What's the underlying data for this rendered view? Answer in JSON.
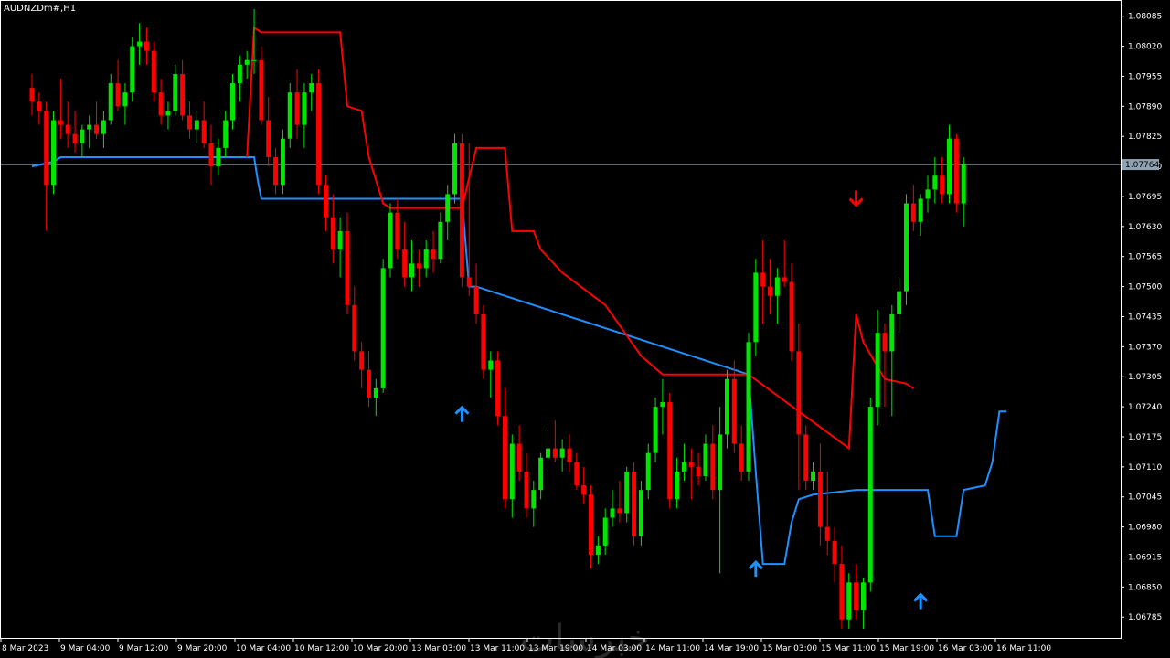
{
  "symbol_label": "AUDNZDm#,H1",
  "watermark": "خبرسات",
  "colors": {
    "background": "#000000",
    "frame": "#ffffff",
    "bull_candle": "#00e600",
    "bear_candle": "#ff0000",
    "support_line": "#1e90ff",
    "resistance_line": "#ff0000",
    "current_price_line": "#8fa3b3",
    "up_arrow": "#1e90ff",
    "down_arrow": "#ff0000"
  },
  "icons": {
    "buy_signal": "arrow-up-icon",
    "sell_signal": "arrow-down-icon"
  },
  "chart_data": {
    "type": "candlestick",
    "symbol": "AUDNZDm#",
    "timeframe": "H1",
    "ylim": [
      1.0674,
      1.0812
    ],
    "y_ticks": [
      "1.08085",
      "1.08020",
      "1.07955",
      "1.07890",
      "1.07825",
      "1.07760",
      "1.07695",
      "1.07630",
      "1.07565",
      "1.07500",
      "1.07435",
      "1.07370",
      "1.07305",
      "1.07240",
      "1.07175",
      "1.07110",
      "1.07045",
      "1.06980",
      "1.06915",
      "1.06850",
      "1.06785"
    ],
    "x_ticks": [
      "8 Mar 2023",
      "9 Mar 04:00",
      "9 Mar 12:00",
      "9 Mar 20:00",
      "10 Mar 04:00",
      "10 Mar 12:00",
      "10 Mar 20:00",
      "13 Mar 03:00",
      "13 Mar 11:00",
      "13 Mar 19:00",
      "14 Mar 03:00",
      "14 Mar 11:00",
      "14 Mar 19:00",
      "15 Mar 03:00",
      "15 Mar 11:00",
      "15 Mar 19:00",
      "16 Mar 03:00",
      "16 Mar 11:00"
    ],
    "current_price": "1.07764",
    "candles": [
      [
        1.0793,
        1.0796,
        1.0787,
        1.079
      ],
      [
        1.079,
        1.0792,
        1.0785,
        1.0788
      ],
      [
        1.0788,
        1.079,
        1.0762,
        1.0772
      ],
      [
        1.0772,
        1.0788,
        1.077,
        1.0786
      ],
      [
        1.0786,
        1.0795,
        1.0782,
        1.0785
      ],
      [
        1.0785,
        1.079,
        1.078,
        1.0783
      ],
      [
        1.0783,
        1.0788,
        1.0779,
        1.0781
      ],
      [
        1.0781,
        1.0785,
        1.0778,
        1.0784
      ],
      [
        1.0784,
        1.0787,
        1.078,
        1.0785
      ],
      [
        1.0785,
        1.079,
        1.0782,
        1.0783
      ],
      [
        1.0783,
        1.0788,
        1.078,
        1.0786
      ],
      [
        1.0786,
        1.0796,
        1.0785,
        1.0794
      ],
      [
        1.0794,
        1.0799,
        1.0788,
        1.0789
      ],
      [
        1.0789,
        1.0794,
        1.0785,
        1.0792
      ],
      [
        1.0792,
        1.0804,
        1.079,
        1.0802
      ],
      [
        1.0802,
        1.0807,
        1.0798,
        1.0803
      ],
      [
        1.0803,
        1.0806,
        1.0798,
        1.0801
      ],
      [
        1.0801,
        1.0803,
        1.079,
        1.0792
      ],
      [
        1.0792,
        1.0795,
        1.0785,
        1.0787
      ],
      [
        1.0787,
        1.079,
        1.0784,
        1.0788
      ],
      [
        1.0788,
        1.0798,
        1.0787,
        1.0796
      ],
      [
        1.0796,
        1.0799,
        1.0786,
        1.0787
      ],
      [
        1.0787,
        1.079,
        1.0782,
        1.0784
      ],
      [
        1.0784,
        1.0788,
        1.0781,
        1.0786
      ],
      [
        1.0786,
        1.079,
        1.078,
        1.0781
      ],
      [
        1.0781,
        1.0785,
        1.0772,
        1.0776
      ],
      [
        1.0776,
        1.0782,
        1.0774,
        1.078
      ],
      [
        1.078,
        1.0788,
        1.0778,
        1.0786
      ],
      [
        1.0786,
        1.0796,
        1.0784,
        1.0794
      ],
      [
        1.0794,
        1.08,
        1.079,
        1.0798
      ],
      [
        1.0798,
        1.0801,
        1.0795,
        1.0799
      ],
      [
        1.0799,
        1.081,
        1.0796,
        1.0799
      ],
      [
        1.0799,
        1.0802,
        1.0785,
        1.0786
      ],
      [
        1.0786,
        1.0791,
        1.0776,
        1.0778
      ],
      [
        1.0778,
        1.078,
        1.077,
        1.0772
      ],
      [
        1.0772,
        1.0784,
        1.077,
        1.0782
      ],
      [
        1.0782,
        1.0794,
        1.078,
        1.0792
      ],
      [
        1.0792,
        1.0797,
        1.0782,
        1.0785
      ],
      [
        1.0785,
        1.0794,
        1.078,
        1.0792
      ],
      [
        1.0792,
        1.0796,
        1.0788,
        1.0794
      ],
      [
        1.0794,
        1.0797,
        1.077,
        1.0772
      ],
      [
        1.0772,
        1.0774,
        1.0762,
        1.0765
      ],
      [
        1.0765,
        1.077,
        1.0755,
        1.0758
      ],
      [
        1.0758,
        1.0765,
        1.0752,
        1.0762
      ],
      [
        1.0762,
        1.0766,
        1.0744,
        1.0746
      ],
      [
        1.0746,
        1.075,
        1.0734,
        1.0736
      ],
      [
        1.0736,
        1.0738,
        1.0728,
        1.0732
      ],
      [
        1.0732,
        1.0736,
        1.0724,
        1.0726
      ],
      [
        1.0726,
        1.073,
        1.0722,
        1.0728
      ],
      [
        1.0728,
        1.0756,
        1.0727,
        1.0754
      ],
      [
        1.0754,
        1.0768,
        1.0752,
        1.0766
      ],
      [
        1.0766,
        1.0769,
        1.0756,
        1.0758
      ],
      [
        1.0758,
        1.0764,
        1.075,
        1.0752
      ],
      [
        1.0752,
        1.076,
        1.0749,
        1.0755
      ],
      [
        1.0755,
        1.0758,
        1.075,
        1.0754
      ],
      [
        1.0754,
        1.076,
        1.0752,
        1.0758
      ],
      [
        1.0758,
        1.0762,
        1.0753,
        1.0756
      ],
      [
        1.0756,
        1.0766,
        1.0755,
        1.0764
      ],
      [
        1.0764,
        1.0772,
        1.076,
        1.077
      ],
      [
        1.077,
        1.0783,
        1.0768,
        1.0781
      ],
      [
        1.0781,
        1.0783,
        1.075,
        1.0752
      ],
      [
        1.0752,
        1.0781,
        1.0748,
        1.075
      ],
      [
        1.075,
        1.0755,
        1.0742,
        1.0744
      ],
      [
        1.0744,
        1.0746,
        1.073,
        1.0732
      ],
      [
        1.0732,
        1.0736,
        1.0726,
        1.0734
      ],
      [
        1.0734,
        1.0736,
        1.072,
        1.0722
      ],
      [
        1.0722,
        1.0728,
        1.0702,
        1.0704
      ],
      [
        1.0704,
        1.0718,
        1.07,
        1.0716
      ],
      [
        1.0716,
        1.072,
        1.0708,
        1.071
      ],
      [
        1.071,
        1.0714,
        1.07,
        1.0702
      ],
      [
        1.0702,
        1.0708,
        1.0698,
        1.0706
      ],
      [
        1.0706,
        1.0714,
        1.0704,
        1.0713
      ],
      [
        1.0713,
        1.0719,
        1.071,
        1.0715
      ],
      [
        1.0715,
        1.0721,
        1.0712,
        1.0713
      ],
      [
        1.0713,
        1.0717,
        1.071,
        1.0715
      ],
      [
        1.0715,
        1.0718,
        1.071,
        1.0712
      ],
      [
        1.0712,
        1.0714,
        1.0706,
        1.0707
      ],
      [
        1.0707,
        1.0711,
        1.0703,
        1.0705
      ],
      [
        1.0705,
        1.0707,
        1.0689,
        1.0692
      ],
      [
        1.0692,
        1.0696,
        1.069,
        1.0694
      ],
      [
        1.0694,
        1.0702,
        1.0692,
        1.07
      ],
      [
        1.07,
        1.0706,
        1.0698,
        1.0702
      ],
      [
        1.0702,
        1.0708,
        1.0699,
        1.0701
      ],
      [
        1.0701,
        1.0711,
        1.0699,
        1.071
      ],
      [
        1.071,
        1.0712,
        1.0694,
        1.0696
      ],
      [
        1.0696,
        1.0708,
        1.0694,
        1.0706
      ],
      [
        1.0706,
        1.0716,
        1.0704,
        1.0714
      ],
      [
        1.0714,
        1.0726,
        1.0712,
        1.0724
      ],
      [
        1.0724,
        1.073,
        1.0718,
        1.0725
      ],
      [
        1.0725,
        1.0727,
        1.0702,
        1.0704
      ],
      [
        1.0704,
        1.0713,
        1.0702,
        1.071
      ],
      [
        1.071,
        1.0716,
        1.0708,
        1.0712
      ],
      [
        1.0712,
        1.0715,
        1.0704,
        1.0711
      ],
      [
        1.0711,
        1.0714,
        1.0707,
        1.0709
      ],
      [
        1.0709,
        1.0718,
        1.0708,
        1.0716
      ],
      [
        1.0716,
        1.072,
        1.0704,
        1.0706
      ],
      [
        1.0706,
        1.0724,
        1.0688,
        1.0718
      ],
      [
        1.0718,
        1.0732,
        1.0715,
        1.073
      ],
      [
        1.073,
        1.0734,
        1.0714,
        1.0716
      ],
      [
        1.0716,
        1.072,
        1.0708,
        1.071
      ],
      [
        1.071,
        1.074,
        1.0708,
        1.0738
      ],
      [
        1.0738,
        1.0756,
        1.0735,
        1.0753
      ],
      [
        1.0753,
        1.076,
        1.0742,
        1.075
      ],
      [
        1.075,
        1.0756,
        1.0744,
        1.0748
      ],
      [
        1.0748,
        1.0754,
        1.0742,
        1.0752
      ],
      [
        1.0752,
        1.076,
        1.075,
        1.0751
      ],
      [
        1.0751,
        1.0755,
        1.0734,
        1.0736
      ],
      [
        1.0736,
        1.0742,
        1.0706,
        1.0718
      ],
      [
        1.0718,
        1.072,
        1.0706,
        1.0708
      ],
      [
        1.0708,
        1.0712,
        1.0706,
        1.071
      ],
      [
        1.071,
        1.0716,
        1.0694,
        1.0698
      ],
      [
        1.0698,
        1.071,
        1.0692,
        1.0695
      ],
      [
        1.0695,
        1.0698,
        1.0686,
        1.069
      ],
      [
        1.069,
        1.0694,
        1.0676,
        1.0678
      ],
      [
        1.0678,
        1.0688,
        1.0676,
        1.0686
      ],
      [
        1.0686,
        1.069,
        1.0678,
        1.068
      ],
      [
        1.068,
        1.0687,
        1.0676,
        1.0686
      ],
      [
        1.0686,
        1.0726,
        1.0684,
        1.0724
      ],
      [
        1.0724,
        1.0745,
        1.072,
        1.074
      ],
      [
        1.074,
        1.0742,
        1.0724,
        1.0736
      ],
      [
        1.0736,
        1.0746,
        1.0722,
        1.0744
      ],
      [
        1.0744,
        1.0752,
        1.074,
        1.0749
      ],
      [
        1.0749,
        1.077,
        1.0746,
        1.0768
      ],
      [
        1.0768,
        1.0772,
        1.0762,
        1.0764
      ],
      [
        1.0764,
        1.077,
        1.0761,
        1.0769
      ],
      [
        1.0769,
        1.0774,
        1.0766,
        1.0771
      ],
      [
        1.0771,
        1.0778,
        1.0768,
        1.0774
      ],
      [
        1.0774,
        1.0778,
        1.0768,
        1.077
      ],
      [
        1.077,
        1.0785,
        1.0768,
        1.0782
      ],
      [
        1.0782,
        1.0783,
        1.0766,
        1.0768
      ],
      [
        1.0768,
        1.0778,
        1.0763,
        1.07764
      ]
    ],
    "support_line": [
      [
        0,
        1.0776
      ],
      [
        3,
        1.0777
      ],
      [
        4,
        1.0778
      ],
      [
        31,
        1.0778
      ],
      [
        31.5,
        1.0773
      ],
      [
        32,
        1.0769
      ],
      [
        60,
        1.0769
      ],
      [
        61,
        1.075
      ],
      [
        62,
        1.075
      ],
      [
        100,
        1.0731
      ],
      [
        101,
        1.071
      ],
      [
        102,
        1.069
      ],
      [
        105,
        1.069
      ],
      [
        106,
        1.0699
      ],
      [
        107,
        1.0704
      ],
      [
        109,
        1.0705
      ],
      [
        115,
        1.0706
      ],
      [
        125,
        1.0706
      ],
      [
        126,
        1.0696
      ],
      [
        129,
        1.0696
      ],
      [
        130,
        1.0706
      ],
      [
        133,
        1.0707
      ],
      [
        134,
        1.0712
      ],
      [
        135,
        1.0723
      ],
      [
        136,
        1.0723
      ]
    ],
    "resistance_line": [
      [
        30,
        1.0778
      ],
      [
        31,
        1.0806
      ],
      [
        32,
        1.0805
      ],
      [
        43,
        1.0805
      ],
      [
        44,
        1.0789
      ],
      [
        46,
        1.0788
      ],
      [
        47,
        1.0778
      ],
      [
        49,
        1.0768
      ],
      [
        50,
        1.0767
      ],
      [
        60,
        1.0767
      ],
      [
        62,
        1.078
      ],
      [
        66,
        1.078
      ],
      [
        67,
        1.0762
      ],
      [
        70,
        1.0762
      ],
      [
        71,
        1.0758
      ],
      [
        74,
        1.0753
      ],
      [
        80,
        1.0746
      ],
      [
        85,
        1.0735
      ],
      [
        88,
        1.0731
      ],
      [
        91,
        1.0731
      ],
      [
        100,
        1.0731
      ],
      [
        114,
        1.0715
      ],
      [
        115,
        1.0744
      ],
      [
        116,
        1.0738
      ],
      [
        119,
        1.073
      ],
      [
        122,
        1.0729
      ],
      [
        123,
        1.0728
      ]
    ],
    "buy_arrows": [
      [
        60,
        1.07225
      ],
      [
        101,
        1.0689
      ],
      [
        124,
        1.0682
      ]
    ],
    "sell_arrows": [
      [
        115,
        1.0769
      ]
    ]
  }
}
